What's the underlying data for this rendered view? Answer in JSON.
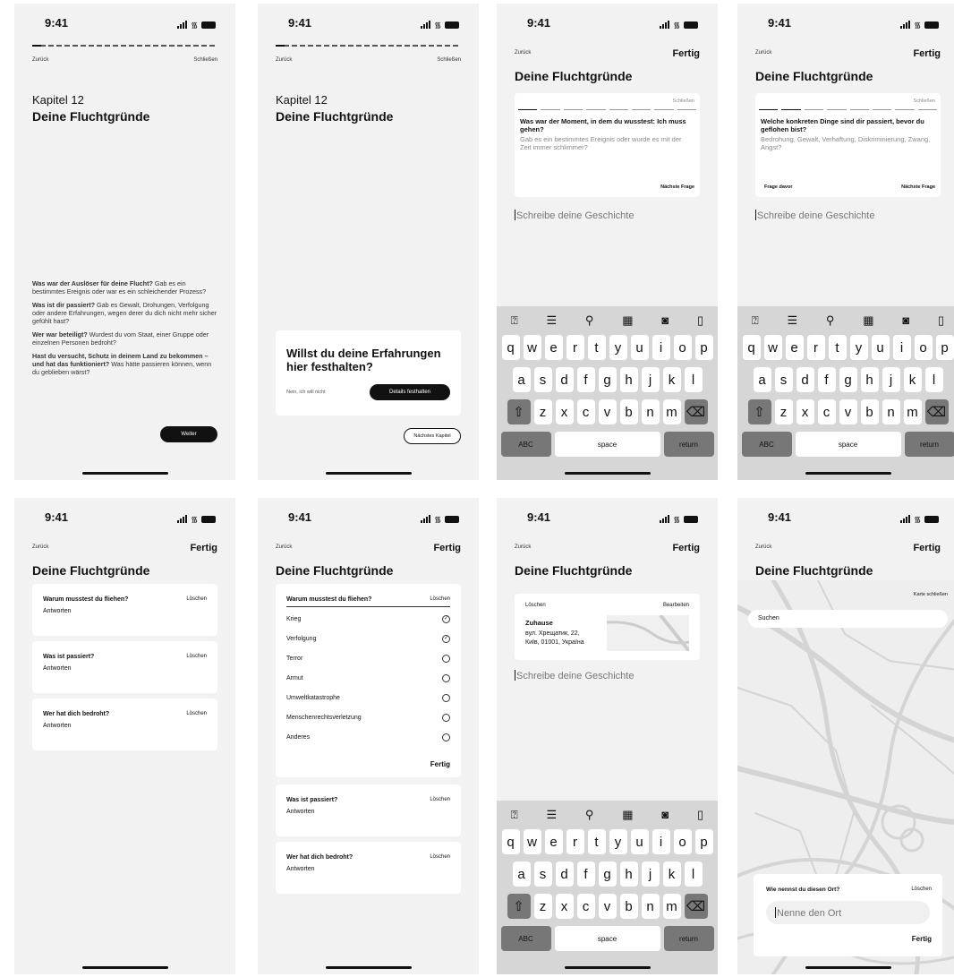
{
  "status": {
    "time": "9:41"
  },
  "common": {
    "back": "Zurück",
    "close": "Schließen",
    "done": "Fertig",
    "page_title": "Deine Fluchtgründe",
    "write_placeholder": "Schreibe deine Geschichte",
    "delete": "Löschen",
    "answers": "Antworten"
  },
  "screen1": {
    "chapter": "Kapitel 12",
    "title": "Deine Fluchtgründe",
    "paragraphs": [
      {
        "bold": "Was war der Auslöser für deine Flucht?",
        "text": " Gab es ein bestimmtes Ereignis oder war es ein schleichender Prozess?"
      },
      {
        "bold": "Was ist dir passiert?",
        "text": " Gab es Gewalt, Drohungen, Verfolgung oder andere Erfahrungen, wegen derer du dich nicht mehr sicher gefühlt hast?"
      },
      {
        "bold": "Wer war beteiligt?",
        "text": " Wurdest du vom Staat, einer Gruppe oder einzelnen Personen bedroht?"
      },
      {
        "bold": "Hast du versucht, Schutz in deinem Land zu bekommen – und hat das funktioniert?",
        "text": " Was hätte passieren können, wenn du geblieben wärst?"
      }
    ],
    "continue": "Weiter"
  },
  "screen2": {
    "chapter": "Kapitel 12",
    "title": "Deine Fluchtgründe",
    "prompt": "Willst du deine Erfahrungen hier festhalten?",
    "no": "Nein, ich will nicht",
    "yes": "Details festhalten",
    "next_chapter": "Nächstes Kapitel"
  },
  "screen3": {
    "question": "Was war der Moment, in dem du wusstest: Ich muss gehen?",
    "hint": "Gab es ein bestimmtes Ereignis oder wurde es mit der Zeit immer schlimmer?",
    "next": "Nächste Frage"
  },
  "screen4": {
    "question": "Welche konkreten Dinge sind dir passiert, bevor du geflohen bist?",
    "hint": "Bedrohung, Gewalt, Verhaftung, Diskriminierung, Zwang, Angst?",
    "prev": "Frage davor",
    "next": "Nächste Frage"
  },
  "keyboard": {
    "row1": [
      "q",
      "w",
      "e",
      "r",
      "t",
      "y",
      "u",
      "i",
      "o",
      "p"
    ],
    "row2": [
      "a",
      "s",
      "d",
      "f",
      "g",
      "h",
      "j",
      "k",
      "l"
    ],
    "row3": [
      "z",
      "x",
      "c",
      "v",
      "b",
      "n",
      "m"
    ],
    "abc": "ABC",
    "space": "space",
    "return": "return",
    "shift": "⇧",
    "backspace": "⌫"
  },
  "toolbar_icons": [
    "help-icon",
    "list-icon",
    "location-icon",
    "calendar-icon",
    "camera-icon",
    "file-icon"
  ],
  "questions": [
    "Warum musstest du fliehen?",
    "Was ist passiert?",
    "Wer hat dich bedroht?"
  ],
  "screen6": {
    "options": [
      {
        "label": "Krieg",
        "checked": true
      },
      {
        "label": "Verfolgung",
        "checked": true
      },
      {
        "label": "Terror",
        "checked": false
      },
      {
        "label": "Armut",
        "checked": false
      },
      {
        "label": "Umweltkatastrophe",
        "checked": false
      },
      {
        "label": "Menschenrechtsverletzung",
        "checked": false
      },
      {
        "label": "Anderes",
        "checked": false
      }
    ]
  },
  "screen7": {
    "edit": "Bearbeiten",
    "place_name": "Zuhause",
    "address_line1": "вул. Хрещатик, 22,",
    "address_line2": "Київ, 01001, Україна"
  },
  "screen8": {
    "close_map": "Karte schließen",
    "search": "Suchen",
    "name_question": "Wie nennst du diesen Ort?",
    "name_placeholder": "Nenne den Ort"
  }
}
